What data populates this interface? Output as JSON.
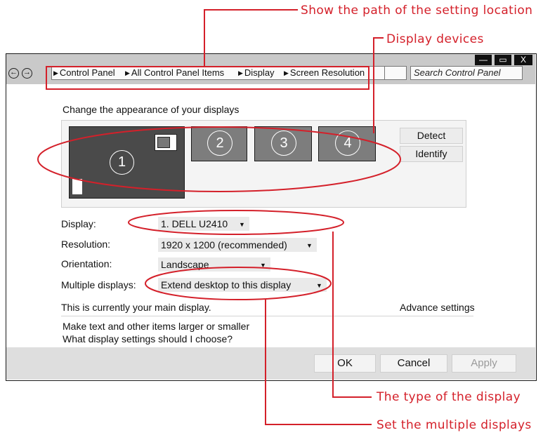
{
  "callouts": {
    "path": "Show the path of the setting location",
    "devices": "Display devices",
    "type": "The type of the display",
    "multiple": "Set the multiple displays"
  },
  "window": {
    "controls": {
      "minimize": "—",
      "maximize": "▭",
      "close": "X"
    },
    "nav": {
      "back": "←",
      "forward": "→"
    },
    "breadcrumb": [
      "Control Panel",
      "All Control Panel Items",
      "Display",
      "Screen Resolution"
    ],
    "search_placeholder": "Search Control Panel"
  },
  "content": {
    "heading": "Change the appearance of your displays",
    "monitors": [
      "1",
      "2",
      "3",
      "4"
    ],
    "detect_label": "Detect",
    "identify_label": "Identify",
    "display": {
      "label": "Display:",
      "value": "1. DELL U2410"
    },
    "resolution": {
      "label": "Resolution:",
      "value": "1920 x 1200 (recommended)"
    },
    "orientation": {
      "label": "Orientation:",
      "value": "Landscape"
    },
    "multiple": {
      "label": "Multiple displays:",
      "value": "Extend desktop to this display"
    },
    "main_display_note": "This is currently your main display.",
    "advance_settings": "Advance settings",
    "link_text_size": "Make text and other items larger or smaller",
    "link_what_settings": "What display settings should I choose?"
  },
  "buttons": {
    "ok": "OK",
    "cancel": "Cancel",
    "apply": "Apply"
  },
  "colors": {
    "annotation": "#d4202a",
    "monitor_primary": "#4a4a4a",
    "monitor_other": "#7d7d7d",
    "chrome": "#c9c9c9"
  }
}
